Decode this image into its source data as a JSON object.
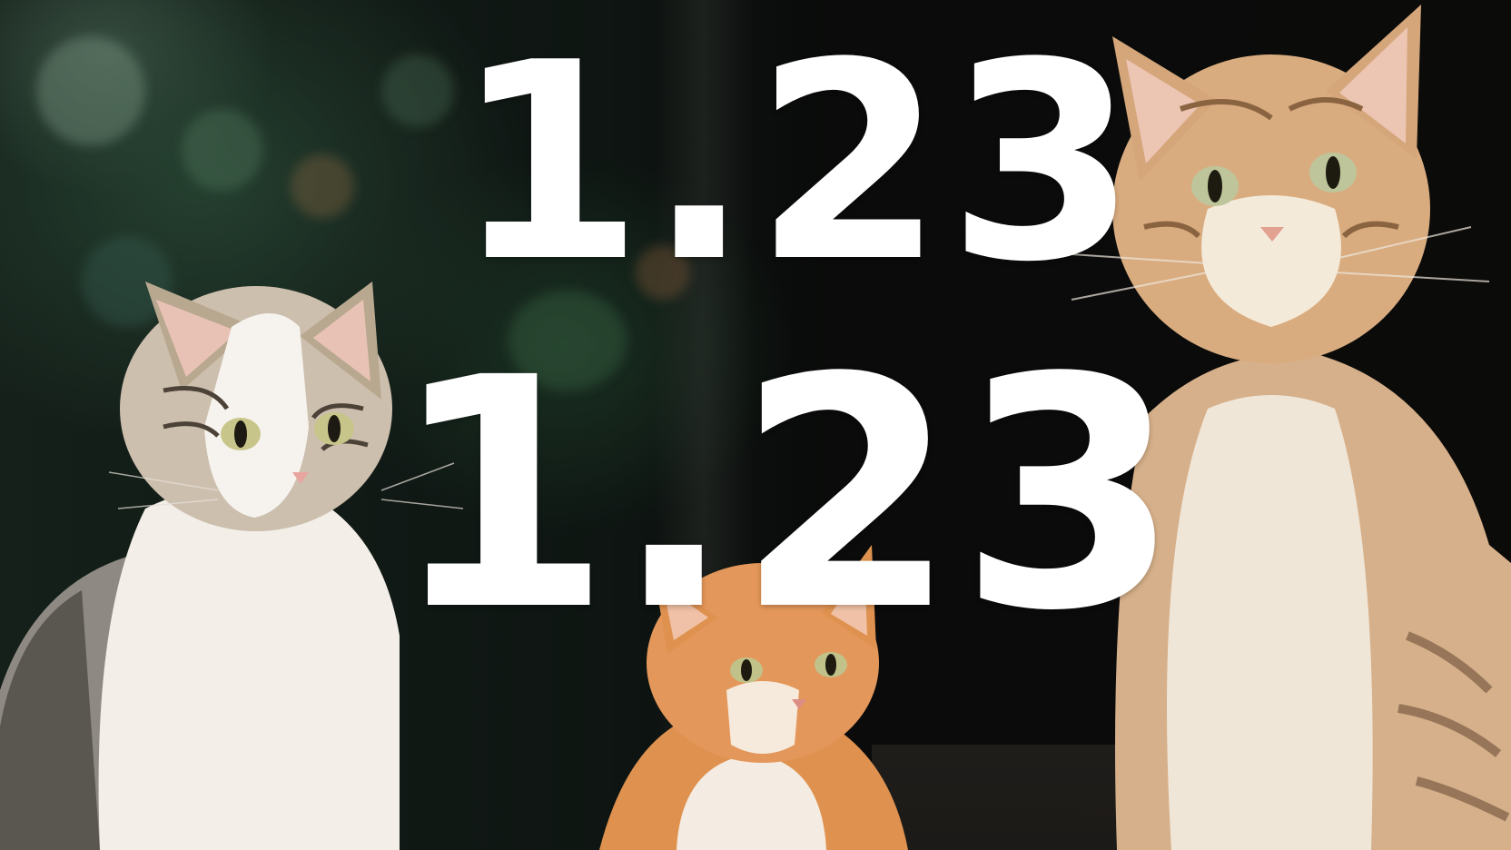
{
  "overlay": {
    "line1": "1.23",
    "line2": "1.23"
  },
  "colors": {
    "text": "#ffffff",
    "tabby_fur": "#c9a27c",
    "orange_fur": "#e2914c",
    "white_fur": "#f2ede6",
    "background": "#0b0c0a",
    "foliage": "#1f3a2a"
  }
}
